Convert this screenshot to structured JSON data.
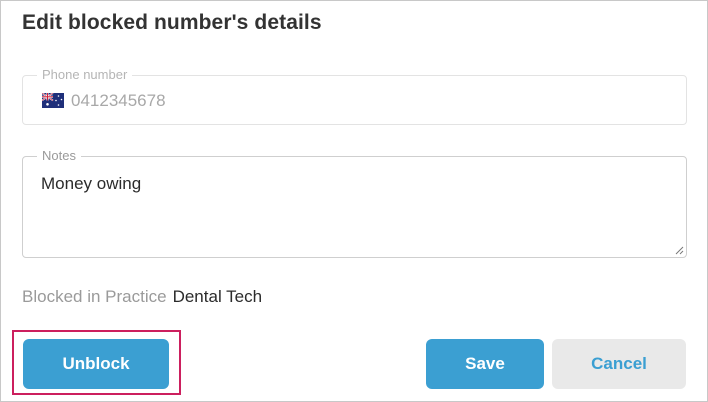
{
  "dialog": {
    "title": "Edit blocked number's details"
  },
  "phone": {
    "label": "Phone number",
    "value": "0412345678",
    "flag_icon": "australia-flag-icon"
  },
  "notes": {
    "label": "Notes",
    "value": "Money owing"
  },
  "blocked_in": {
    "label": "Blocked in Practice",
    "value": "Dental Tech"
  },
  "actions": {
    "unblock_label": "Unblock",
    "save_label": "Save",
    "cancel_label": "Cancel"
  },
  "colors": {
    "primary": "#3b9fd2",
    "secondary_bg": "#e9e9e9",
    "highlight": "#cc1f5e"
  }
}
